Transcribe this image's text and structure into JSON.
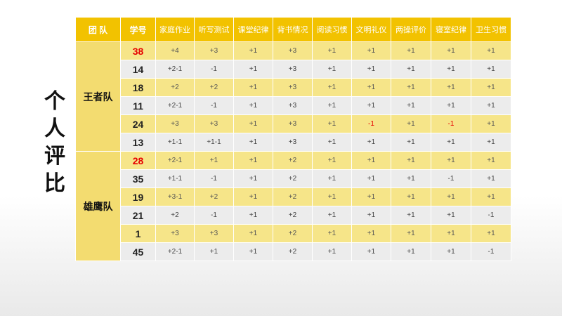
{
  "side_title": [
    "个",
    "人",
    "评",
    "比"
  ],
  "headers": [
    "团 队",
    "学号",
    "家庭作业",
    "听写测试",
    "课堂纪律",
    "背书情况",
    "阅读习惯",
    "文明礼仪",
    "两操评价",
    "寝室纪律",
    "卫生习惯"
  ],
  "teams": [
    {
      "name": "王者队",
      "rows": [
        {
          "id": "38",
          "highlight": true,
          "scores": [
            "+4",
            "+3",
            "+1",
            "+3",
            "+1",
            "+1",
            "+1",
            "+1",
            "+1"
          ],
          "red": []
        },
        {
          "id": "14",
          "highlight": false,
          "scores": [
            "+2-1",
            "-1",
            "+1",
            "+3",
            "+1",
            "+1",
            "+1",
            "+1",
            "+1"
          ],
          "red": []
        },
        {
          "id": "18",
          "highlight": false,
          "scores": [
            "+2",
            "+2",
            "+1",
            "+3",
            "+1",
            "+1",
            "+1",
            "+1",
            "+1"
          ],
          "red": []
        },
        {
          "id": "11",
          "highlight": false,
          "scores": [
            "+2-1",
            "-1",
            "+1",
            "+3",
            "+1",
            "+1",
            "+1",
            "+1",
            "+1"
          ],
          "red": []
        },
        {
          "id": "24",
          "highlight": false,
          "scores": [
            "+3",
            "+3",
            "+1",
            "+3",
            "+1",
            "-1",
            "+1",
            "-1",
            "+1"
          ],
          "red": [
            5,
            7
          ]
        },
        {
          "id": "13",
          "highlight": false,
          "scores": [
            "+1-1",
            "+1-1",
            "+1",
            "+3",
            "+1",
            "+1",
            "+1",
            "+1",
            "+1"
          ],
          "red": []
        }
      ]
    },
    {
      "name": "雄鹰队",
      "rows": [
        {
          "id": "28",
          "highlight": true,
          "scores": [
            "+2-1",
            "+1",
            "+1",
            "+2",
            "+1",
            "+1",
            "+1",
            "+1",
            "+1"
          ],
          "red": []
        },
        {
          "id": "35",
          "highlight": false,
          "scores": [
            "+1-1",
            "-1",
            "+1",
            "+2",
            "+1",
            "+1",
            "+1",
            "-1",
            "+1"
          ],
          "red": [
            0,
            7
          ]
        },
        {
          "id": "19",
          "highlight": false,
          "scores": [
            "+3-1",
            "+2",
            "+1",
            "+2",
            "+1",
            "+1",
            "+1",
            "+1",
            "+1"
          ],
          "red": []
        },
        {
          "id": "21",
          "highlight": false,
          "scores": [
            "+2",
            "-1",
            "+1",
            "+2",
            "+1",
            "+1",
            "+1",
            "+1",
            "-1"
          ],
          "red": [
            8
          ]
        },
        {
          "id": "1",
          "highlight": false,
          "scores": [
            "+3",
            "+3",
            "+1",
            "+2",
            "+1",
            "+1",
            "+1",
            "+1",
            "+1"
          ],
          "red": []
        },
        {
          "id": "45",
          "highlight": false,
          "scores": [
            "+2-1",
            "+1",
            "+1",
            "+2",
            "+1",
            "+1",
            "+1",
            "+1",
            "-1"
          ],
          "red": [
            8
          ]
        }
      ]
    }
  ],
  "colors": {
    "header_bg": "#f2c200",
    "band_yellow": "#f6e589",
    "band_gray": "#ececec",
    "penalty": "#e60000"
  }
}
